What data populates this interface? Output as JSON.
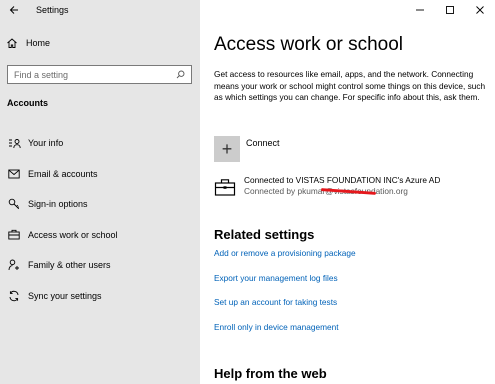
{
  "window": {
    "title": "Settings"
  },
  "sidebar": {
    "home_label": "Home",
    "search_placeholder": "Find a setting",
    "section_title": "Accounts",
    "items": [
      {
        "label": "Your info",
        "icon": "your-info-icon"
      },
      {
        "label": "Email & accounts",
        "icon": "email-icon"
      },
      {
        "label": "Sign-in options",
        "icon": "key-icon"
      },
      {
        "label": "Access work or school",
        "icon": "briefcase-icon"
      },
      {
        "label": "Family & other users",
        "icon": "person-plus-icon"
      },
      {
        "label": "Sync your settings",
        "icon": "sync-icon"
      }
    ]
  },
  "main": {
    "title": "Access work or school",
    "description": "Get access to resources like email, apps, and the network. Connecting means your work or school might control some things on this device, such as which settings you can change. For specific info about this, ask them.",
    "connect_label": "Connect",
    "connect_symbol": "+",
    "account": {
      "title": "Connected to VISTAS FOUNDATION INC's Azure AD",
      "subtitle": "Connected by pkumar@vistasfoundation.org"
    },
    "related_title": "Related settings",
    "related_links": [
      "Add or remove a provisioning package",
      "Export your management log files",
      "Set up an account for taking tests",
      "Enroll only in device management"
    ],
    "help_title": "Help from the web"
  },
  "colors": {
    "sidebar_bg": "#e6e6e6",
    "link": "#0062b8",
    "redaction": "#e5171c"
  }
}
